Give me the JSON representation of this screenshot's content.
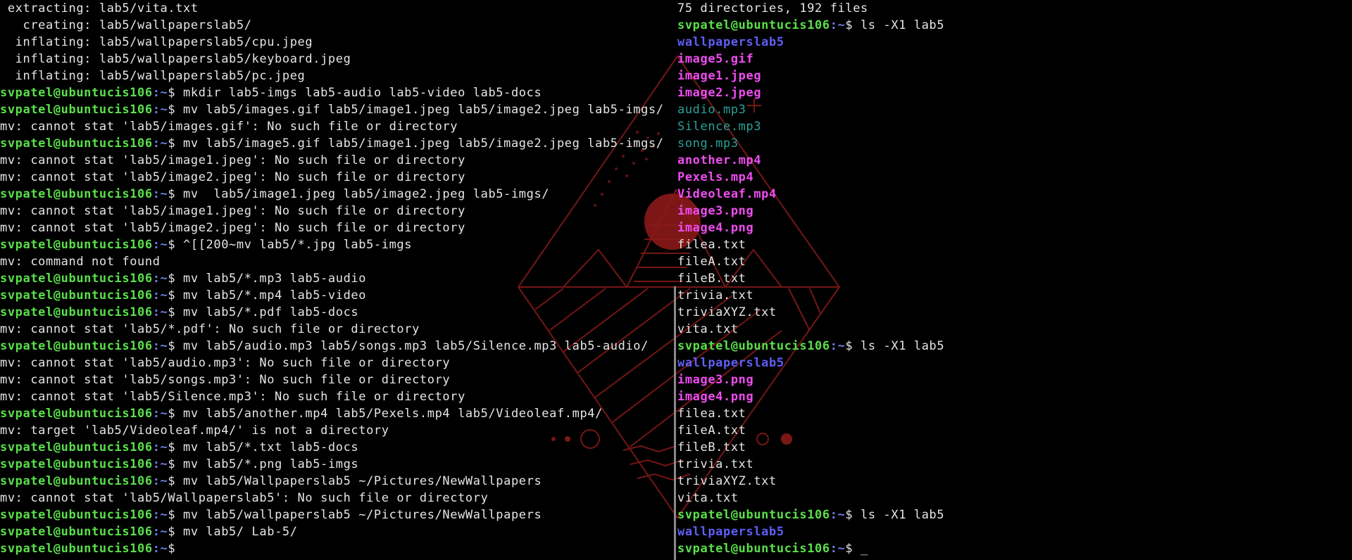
{
  "prompt": {
    "user_host": "svpatel@ubuntucis106",
    "path": ":~",
    "symbol": "$ "
  },
  "colors": {
    "background": "#000000",
    "prompt_green": "#5ae04a",
    "directory_blue": "#5f5ff5",
    "image_magenta": "#f04cf0",
    "audio_cyan": "#2aa198",
    "wallpaper_red": "#8b1a1a"
  },
  "left_pane": {
    "lines": [
      {
        "type": "out",
        "text": " extracting: lab5/vita.txt"
      },
      {
        "type": "out",
        "text": "   creating: lab5/wallpaperslab5/"
      },
      {
        "type": "out",
        "text": "  inflating: lab5/wallpaperslab5/cpu.jpeg"
      },
      {
        "type": "out",
        "text": "  inflating: lab5/wallpaperslab5/keyboard.jpeg"
      },
      {
        "type": "out",
        "text": "  inflating: lab5/wallpaperslab5/pc.jpeg"
      },
      {
        "type": "cmd",
        "text": "mkdir lab5-imgs lab5-audio lab5-video lab5-docs"
      },
      {
        "type": "cmd",
        "text": "mv lab5/images.gif lab5/image1.jpeg lab5/image2.jpeg lab5-imgs/"
      },
      {
        "type": "out",
        "text": "mv: cannot stat 'lab5/images.gif': No such file or directory"
      },
      {
        "type": "cmd",
        "text": "mv lab5/image5.gif lab5/image1.jpeg lab5/image2.jpeg lab5-imgs/"
      },
      {
        "type": "out",
        "text": "mv: cannot stat 'lab5/image1.jpeg': No such file or directory"
      },
      {
        "type": "out",
        "text": "mv: cannot stat 'lab5/image2.jpeg': No such file or directory"
      },
      {
        "type": "cmd",
        "text": "mv  lab5/image1.jpeg lab5/image2.jpeg lab5-imgs/"
      },
      {
        "type": "out",
        "text": "mv: cannot stat 'lab5/image1.jpeg': No such file or directory"
      },
      {
        "type": "out",
        "text": "mv: cannot stat 'lab5/image2.jpeg': No such file or directory"
      },
      {
        "type": "cmd",
        "text": "^[[200~mv lab5/*.jpg lab5-imgs"
      },
      {
        "type": "out",
        "text": "mv: command not found"
      },
      {
        "type": "cmd",
        "text": "mv lab5/*.mp3 lab5-audio"
      },
      {
        "type": "cmd",
        "text": "mv lab5/*.mp4 lab5-video"
      },
      {
        "type": "cmd",
        "text": "mv lab5/*.pdf lab5-docs"
      },
      {
        "type": "out",
        "text": "mv: cannot stat 'lab5/*.pdf': No such file or directory"
      },
      {
        "type": "cmd",
        "text": "mv lab5/audio.mp3 lab5/songs.mp3 lab5/Silence.mp3 lab5-audio/"
      },
      {
        "type": "out",
        "text": "mv: cannot stat 'lab5/audio.mp3': No such file or directory"
      },
      {
        "type": "out",
        "text": "mv: cannot stat 'lab5/songs.mp3': No such file or directory"
      },
      {
        "type": "out",
        "text": "mv: cannot stat 'lab5/Silence.mp3': No such file or directory"
      },
      {
        "type": "cmd",
        "text": "mv lab5/another.mp4 lab5/Pexels.mp4 lab5/Videoleaf.mp4/"
      },
      {
        "type": "out",
        "text": "mv: target 'lab5/Videoleaf.mp4/' is not a directory"
      },
      {
        "type": "cmd",
        "text": "mv lab5/*.txt lab5-docs"
      },
      {
        "type": "cmd",
        "text": "mv lab5/*.png lab5-imgs"
      },
      {
        "type": "cmd",
        "text": "mv lab5/Wallpaperslab5 ~/Pictures/NewWallpapers"
      },
      {
        "type": "out",
        "text": "mv: cannot stat 'lab5/Wallpaperslab5': No such file or directory"
      },
      {
        "type": "cmd",
        "text": "mv lab5/wallpaperslab5 ~/Pictures/NewWallpapers"
      },
      {
        "type": "cmd",
        "text": "mv lab5/ Lab-5/"
      },
      {
        "type": "cmd",
        "text": ""
      }
    ]
  },
  "right_pane": {
    "lines": [
      {
        "type": "out",
        "text": "75 directories, 192 files"
      },
      {
        "type": "cmd",
        "text": "ls -X1 lab5"
      },
      {
        "type": "dir",
        "text": "wallpaperslab5"
      },
      {
        "type": "img",
        "text": "image5.gif"
      },
      {
        "type": "img",
        "text": "image1.jpeg"
      },
      {
        "type": "img",
        "text": "image2.jpeg"
      },
      {
        "type": "audio",
        "text": "audio.mp3"
      },
      {
        "type": "audio",
        "text": "Silence.mp3"
      },
      {
        "type": "audio",
        "text": "song.mp3"
      },
      {
        "type": "img",
        "text": "another.mp4"
      },
      {
        "type": "img",
        "text": "Pexels.mp4"
      },
      {
        "type": "img",
        "text": "Videoleaf.mp4"
      },
      {
        "type": "img",
        "text": "image3.png"
      },
      {
        "type": "img",
        "text": "image4.png"
      },
      {
        "type": "plain",
        "text": "filea.txt"
      },
      {
        "type": "plain",
        "text": "fileA.txt"
      },
      {
        "type": "plain",
        "text": "fileB.txt"
      },
      {
        "type": "plain",
        "text": "trivia.txt"
      },
      {
        "type": "plain",
        "text": "triviaXYZ.txt"
      },
      {
        "type": "plain",
        "text": "vita.txt"
      },
      {
        "type": "cmd",
        "text": "ls -X1 lab5"
      },
      {
        "type": "dir",
        "text": "wallpaperslab5"
      },
      {
        "type": "img",
        "text": "image3.png"
      },
      {
        "type": "img",
        "text": "image4.png"
      },
      {
        "type": "plain",
        "text": "filea.txt"
      },
      {
        "type": "plain",
        "text": "fileA.txt"
      },
      {
        "type": "plain",
        "text": "fileB.txt"
      },
      {
        "type": "plain",
        "text": "trivia.txt"
      },
      {
        "type": "plain",
        "text": "triviaXYZ.txt"
      },
      {
        "type": "plain",
        "text": "vita.txt"
      },
      {
        "type": "cmd",
        "text": "ls -X1 lab5"
      },
      {
        "type": "dir",
        "text": "wallpaperslab5"
      },
      {
        "type": "cmd",
        "text": "",
        "cursor": "_"
      }
    ]
  }
}
